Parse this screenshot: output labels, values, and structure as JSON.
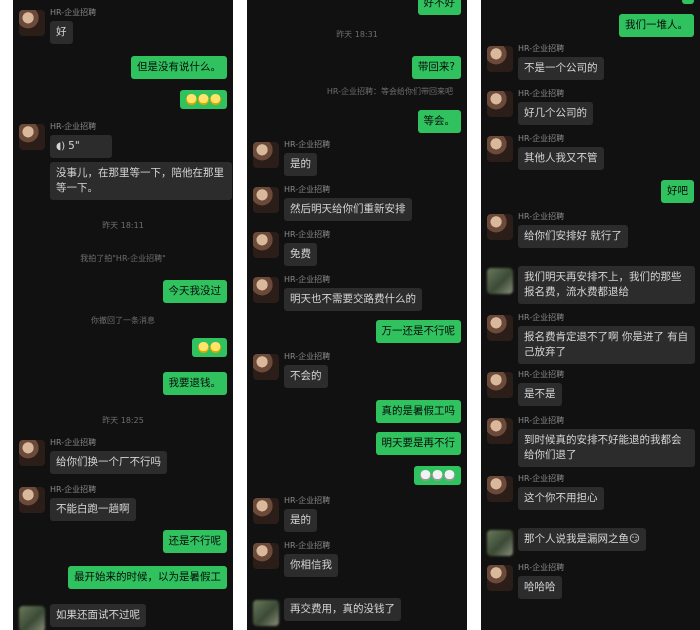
{
  "p1": {
    "messages": [
      {
        "dir": "in",
        "name": "HR-企业招聘",
        "text": "好"
      },
      {
        "dir": "out",
        "text": "但是没有说什么。"
      },
      {
        "dir": "out",
        "emoji": "yellow",
        "count": 3
      },
      {
        "dir": "in",
        "name": "HR-企业招聘",
        "text": "5\""
      },
      {
        "dir": "in",
        "text": "没事儿，在那里等一下，陪他在那里等一下。"
      },
      {
        "dir": "out",
        "text": "今天我没过"
      },
      {
        "dir": "out",
        "emoji": "yellow",
        "count": 2
      },
      {
        "dir": "out",
        "text": "我要退钱。"
      },
      {
        "dir": "in",
        "name": "HR-企业招聘",
        "text": "给你们换一个厂不行吗"
      },
      {
        "dir": "in",
        "name": "HR-企业招聘",
        "text": "不能白跑一趟啊"
      },
      {
        "dir": "out",
        "text": "还是不行呢"
      },
      {
        "dir": "out",
        "text": "最开始来的时候，以为是暑假工"
      },
      {
        "dir": "in",
        "text": "如果还面试不过呢"
      }
    ],
    "system": [
      "昨天 18:11",
      "我拍了拍\"HR-企业招聘\"",
      "你撤回了一条消息",
      "昨天 18:25"
    ]
  },
  "p2": {
    "top_partial": "好不好",
    "system": [
      "昨天 18:31",
      "HR-企业招聘：等会给你们带回来吧"
    ],
    "messages": [
      {
        "dir": "out",
        "text": "带回来?"
      },
      {
        "dir": "out",
        "text": "等会。"
      },
      {
        "dir": "in",
        "name": "HR-企业招聘",
        "text": "是的"
      },
      {
        "dir": "in",
        "name": "HR-企业招聘",
        "text": "然后明天给你们重新安排"
      },
      {
        "dir": "in",
        "name": "HR-企业招聘",
        "text": "免费"
      },
      {
        "dir": "in",
        "name": "HR-企业招聘",
        "text": "明天也不需要交路费什么的"
      },
      {
        "dir": "out",
        "text": "万一还是不行呢"
      },
      {
        "dir": "in",
        "name": "HR-企业招聘",
        "text": "不会的"
      },
      {
        "dir": "out",
        "text": "真的是暑假工吗"
      },
      {
        "dir": "out",
        "text": "明天要是再不行"
      },
      {
        "dir": "out",
        "emoji": "skull",
        "count": 3
      },
      {
        "dir": "in",
        "name": "HR-企业招聘",
        "text": "是的"
      },
      {
        "dir": "in",
        "name": "HR-企业招聘",
        "text": "你相信我"
      },
      {
        "dir": "in",
        "text": "再交费用，真的没钱了"
      }
    ]
  },
  "p3": {
    "messages": [
      {
        "dir": "out",
        "text": "我们一堆人。"
      },
      {
        "dir": "in",
        "name": "HR-企业招聘",
        "text": "不是一个公司的"
      },
      {
        "dir": "in",
        "name": "HR-企业招聘",
        "text": "好几个公司的"
      },
      {
        "dir": "in",
        "name": "HR-企业招聘",
        "text": "其他人我又不管"
      },
      {
        "dir": "out",
        "text": "好吧"
      },
      {
        "dir": "in",
        "name": "HR-企业招聘",
        "text": "给你们安排好 就行了"
      },
      {
        "dir": "in",
        "text": "我们明天再安排不上，我们的那些报名费，流水费都退给"
      },
      {
        "dir": "in",
        "name": "HR-企业招聘",
        "text": "报名费肯定退不了啊 你是进了 有自己放弃了"
      },
      {
        "dir": "in",
        "name": "HR-企业招聘",
        "text": "是不是"
      },
      {
        "dir": "in",
        "name": "HR-企业招聘",
        "text": "到时候真的安排不好能退的我都会给你们退了"
      },
      {
        "dir": "in",
        "name": "HR-企业招聘",
        "text": "这个你不用担心"
      },
      {
        "dir": "in",
        "text": "那个人说我是漏网之鱼😏"
      },
      {
        "dir": "in",
        "name": "HR-企业招聘",
        "text": "哈哈哈"
      }
    ]
  }
}
